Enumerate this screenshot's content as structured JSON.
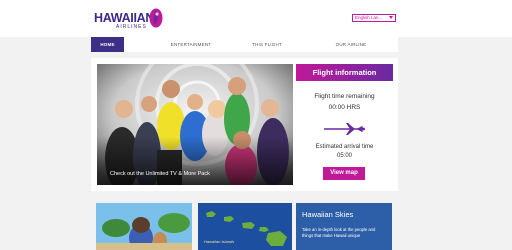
{
  "brand": {
    "name": "HAWAIIAN",
    "sub": "AIRLINES",
    "color": "#3a2a8c",
    "accent": "#c0199a"
  },
  "language": {
    "selected": "English Lan..."
  },
  "nav": {
    "items": [
      {
        "label": "HOME",
        "active": true
      },
      {
        "label": "ENTERTAINMENT",
        "active": false
      },
      {
        "label": "THIS FLIGHT",
        "active": false
      },
      {
        "label": "OUR AIRLINE",
        "active": false
      }
    ]
  },
  "carousel": {
    "caption": "Check out the Unlimited TV & More Pack",
    "dots": 3,
    "active_dot": 1
  },
  "flight_info": {
    "title": "Flight information",
    "remaining_label": "Flight time remaining",
    "remaining_value": "00:00 HRS",
    "arrival_label": "Estimated arrival time",
    "arrival_value": "05:00",
    "button": "View map"
  },
  "tiles": {
    "map_label": "Hawaiian Islands",
    "skies_title": "Hawaiian Skies",
    "skies_desc": "Take an in-depth look at the people and things that make Hawaii unique"
  }
}
